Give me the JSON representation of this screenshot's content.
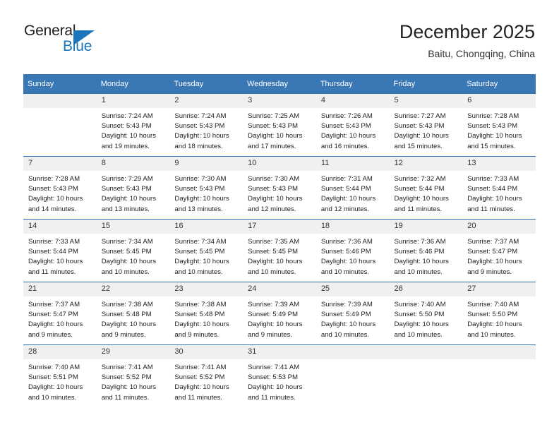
{
  "brand": {
    "word_one": "General",
    "word_two": "Blue",
    "flag_icon": "triangle-flag-icon",
    "accent_color": "#1b75bb"
  },
  "header": {
    "title": "December 2025",
    "subtitle": "Baitu, Chongqing, China"
  },
  "calendar": {
    "header_color": "#3a77b5",
    "daynum_strip_color": "#f0f0f0",
    "weekdays": [
      "Sunday",
      "Monday",
      "Tuesday",
      "Wednesday",
      "Thursday",
      "Friday",
      "Saturday"
    ],
    "weeks": [
      [
        {
          "day": "",
          "sunrise": "",
          "sunset": "",
          "daylight_line1": "",
          "daylight_line2": "",
          "empty": true
        },
        {
          "day": "1",
          "sunrise": "Sunrise: 7:24 AM",
          "sunset": "Sunset: 5:43 PM",
          "daylight_line1": "Daylight: 10 hours",
          "daylight_line2": "and 19 minutes."
        },
        {
          "day": "2",
          "sunrise": "Sunrise: 7:24 AM",
          "sunset": "Sunset: 5:43 PM",
          "daylight_line1": "Daylight: 10 hours",
          "daylight_line2": "and 18 minutes."
        },
        {
          "day": "3",
          "sunrise": "Sunrise: 7:25 AM",
          "sunset": "Sunset: 5:43 PM",
          "daylight_line1": "Daylight: 10 hours",
          "daylight_line2": "and 17 minutes."
        },
        {
          "day": "4",
          "sunrise": "Sunrise: 7:26 AM",
          "sunset": "Sunset: 5:43 PM",
          "daylight_line1": "Daylight: 10 hours",
          "daylight_line2": "and 16 minutes."
        },
        {
          "day": "5",
          "sunrise": "Sunrise: 7:27 AM",
          "sunset": "Sunset: 5:43 PM",
          "daylight_line1": "Daylight: 10 hours",
          "daylight_line2": "and 15 minutes."
        },
        {
          "day": "6",
          "sunrise": "Sunrise: 7:28 AM",
          "sunset": "Sunset: 5:43 PM",
          "daylight_line1": "Daylight: 10 hours",
          "daylight_line2": "and 15 minutes."
        }
      ],
      [
        {
          "day": "7",
          "sunrise": "Sunrise: 7:28 AM",
          "sunset": "Sunset: 5:43 PM",
          "daylight_line1": "Daylight: 10 hours",
          "daylight_line2": "and 14 minutes."
        },
        {
          "day": "8",
          "sunrise": "Sunrise: 7:29 AM",
          "sunset": "Sunset: 5:43 PM",
          "daylight_line1": "Daylight: 10 hours",
          "daylight_line2": "and 13 minutes."
        },
        {
          "day": "9",
          "sunrise": "Sunrise: 7:30 AM",
          "sunset": "Sunset: 5:43 PM",
          "daylight_line1": "Daylight: 10 hours",
          "daylight_line2": "and 13 minutes."
        },
        {
          "day": "10",
          "sunrise": "Sunrise: 7:30 AM",
          "sunset": "Sunset: 5:43 PM",
          "daylight_line1": "Daylight: 10 hours",
          "daylight_line2": "and 12 minutes."
        },
        {
          "day": "11",
          "sunrise": "Sunrise: 7:31 AM",
          "sunset": "Sunset: 5:44 PM",
          "daylight_line1": "Daylight: 10 hours",
          "daylight_line2": "and 12 minutes."
        },
        {
          "day": "12",
          "sunrise": "Sunrise: 7:32 AM",
          "sunset": "Sunset: 5:44 PM",
          "daylight_line1": "Daylight: 10 hours",
          "daylight_line2": "and 11 minutes."
        },
        {
          "day": "13",
          "sunrise": "Sunrise: 7:33 AM",
          "sunset": "Sunset: 5:44 PM",
          "daylight_line1": "Daylight: 10 hours",
          "daylight_line2": "and 11 minutes."
        }
      ],
      [
        {
          "day": "14",
          "sunrise": "Sunrise: 7:33 AM",
          "sunset": "Sunset: 5:44 PM",
          "daylight_line1": "Daylight: 10 hours",
          "daylight_line2": "and 11 minutes."
        },
        {
          "day": "15",
          "sunrise": "Sunrise: 7:34 AM",
          "sunset": "Sunset: 5:45 PM",
          "daylight_line1": "Daylight: 10 hours",
          "daylight_line2": "and 10 minutes."
        },
        {
          "day": "16",
          "sunrise": "Sunrise: 7:34 AM",
          "sunset": "Sunset: 5:45 PM",
          "daylight_line1": "Daylight: 10 hours",
          "daylight_line2": "and 10 minutes."
        },
        {
          "day": "17",
          "sunrise": "Sunrise: 7:35 AM",
          "sunset": "Sunset: 5:45 PM",
          "daylight_line1": "Daylight: 10 hours",
          "daylight_line2": "and 10 minutes."
        },
        {
          "day": "18",
          "sunrise": "Sunrise: 7:36 AM",
          "sunset": "Sunset: 5:46 PM",
          "daylight_line1": "Daylight: 10 hours",
          "daylight_line2": "and 10 minutes."
        },
        {
          "day": "19",
          "sunrise": "Sunrise: 7:36 AM",
          "sunset": "Sunset: 5:46 PM",
          "daylight_line1": "Daylight: 10 hours",
          "daylight_line2": "and 10 minutes."
        },
        {
          "day": "20",
          "sunrise": "Sunrise: 7:37 AM",
          "sunset": "Sunset: 5:47 PM",
          "daylight_line1": "Daylight: 10 hours",
          "daylight_line2": "and 9 minutes."
        }
      ],
      [
        {
          "day": "21",
          "sunrise": "Sunrise: 7:37 AM",
          "sunset": "Sunset: 5:47 PM",
          "daylight_line1": "Daylight: 10 hours",
          "daylight_line2": "and 9 minutes."
        },
        {
          "day": "22",
          "sunrise": "Sunrise: 7:38 AM",
          "sunset": "Sunset: 5:48 PM",
          "daylight_line1": "Daylight: 10 hours",
          "daylight_line2": "and 9 minutes."
        },
        {
          "day": "23",
          "sunrise": "Sunrise: 7:38 AM",
          "sunset": "Sunset: 5:48 PM",
          "daylight_line1": "Daylight: 10 hours",
          "daylight_line2": "and 9 minutes."
        },
        {
          "day": "24",
          "sunrise": "Sunrise: 7:39 AM",
          "sunset": "Sunset: 5:49 PM",
          "daylight_line1": "Daylight: 10 hours",
          "daylight_line2": "and 9 minutes."
        },
        {
          "day": "25",
          "sunrise": "Sunrise: 7:39 AM",
          "sunset": "Sunset: 5:49 PM",
          "daylight_line1": "Daylight: 10 hours",
          "daylight_line2": "and 10 minutes."
        },
        {
          "day": "26",
          "sunrise": "Sunrise: 7:40 AM",
          "sunset": "Sunset: 5:50 PM",
          "daylight_line1": "Daylight: 10 hours",
          "daylight_line2": "and 10 minutes."
        },
        {
          "day": "27",
          "sunrise": "Sunrise: 7:40 AM",
          "sunset": "Sunset: 5:50 PM",
          "daylight_line1": "Daylight: 10 hours",
          "daylight_line2": "and 10 minutes."
        }
      ],
      [
        {
          "day": "28",
          "sunrise": "Sunrise: 7:40 AM",
          "sunset": "Sunset: 5:51 PM",
          "daylight_line1": "Daylight: 10 hours",
          "daylight_line2": "and 10 minutes."
        },
        {
          "day": "29",
          "sunrise": "Sunrise: 7:41 AM",
          "sunset": "Sunset: 5:52 PM",
          "daylight_line1": "Daylight: 10 hours",
          "daylight_line2": "and 11 minutes."
        },
        {
          "day": "30",
          "sunrise": "Sunrise: 7:41 AM",
          "sunset": "Sunset: 5:52 PM",
          "daylight_line1": "Daylight: 10 hours",
          "daylight_line2": "and 11 minutes."
        },
        {
          "day": "31",
          "sunrise": "Sunrise: 7:41 AM",
          "sunset": "Sunset: 5:53 PM",
          "daylight_line1": "Daylight: 10 hours",
          "daylight_line2": "and 11 minutes."
        },
        {
          "day": "",
          "sunrise": "",
          "sunset": "",
          "daylight_line1": "",
          "daylight_line2": "",
          "empty": true
        },
        {
          "day": "",
          "sunrise": "",
          "sunset": "",
          "daylight_line1": "",
          "daylight_line2": "",
          "empty": true
        },
        {
          "day": "",
          "sunrise": "",
          "sunset": "",
          "daylight_line1": "",
          "daylight_line2": "",
          "empty": true
        }
      ]
    ]
  }
}
